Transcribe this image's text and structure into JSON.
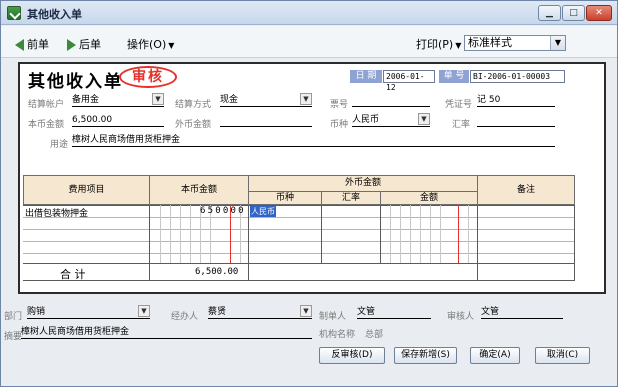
{
  "window": {
    "title": "其他收入单"
  },
  "toolbar": {
    "prev_label": "前单",
    "next_label": "后单",
    "ops_label": "操作(O)",
    "print_label": "打印(P)",
    "style_value": "标准样式"
  },
  "form": {
    "title": "其他收入单",
    "stamp": "审核",
    "date_label": "日 期",
    "date_value": "2006-01-12",
    "no_label": "单 号",
    "no_value": "BI-2006-01-00003",
    "account_label": "结算帐户",
    "account_value": "备用金",
    "method_label": "结算方式",
    "method_value": "现金",
    "ticket_label": "票号",
    "ticket_value": "",
    "voucher_label": "凭证号",
    "voucher_value": "记 50",
    "local_amount_label": "本币金额",
    "local_amount_value": "6,500.00",
    "foreign_amount_label": "外币金额",
    "foreign_amount_value": "",
    "currency_label": "币种",
    "currency_value": "人民币",
    "rate_label": "汇率",
    "rate_value": "",
    "purpose_label": "用途",
    "purpose_value": "樟树人民商场借用货柜押金"
  },
  "grid": {
    "headers": {
      "item": "费用项目",
      "local": "本币金额",
      "foreign": "外币金额",
      "currency": "币种",
      "rate": "汇率",
      "amount": "金额",
      "note": "备注"
    },
    "rows": [
      {
        "item": "出借包装物押金",
        "local_digits": "650000",
        "currency": "人民币"
      }
    ],
    "total_label": "合  计",
    "total_value": "6,500.00"
  },
  "footer": {
    "dept_label": "部门",
    "dept_value": "购销",
    "handler_label": "经办人",
    "handler_value": "蔡贤",
    "maker_label": "制单人",
    "maker_value": "文管",
    "auditor_label": "审核人",
    "auditor_value": "文管",
    "summary_label": "摘要",
    "summary_value": "樟树人民商场借用货柜押金",
    "org_label": "机构名称",
    "org_value": "总部"
  },
  "buttons": {
    "unaudit": "反审核(D)",
    "save_new": "保存新增(S)",
    "ok": "确定(A)",
    "cancel": "取消(C)"
  },
  "colors": {
    "stamp": "#e5312a",
    "header_bg": "#f5e7d0",
    "label_box": "#8ea2d4"
  }
}
